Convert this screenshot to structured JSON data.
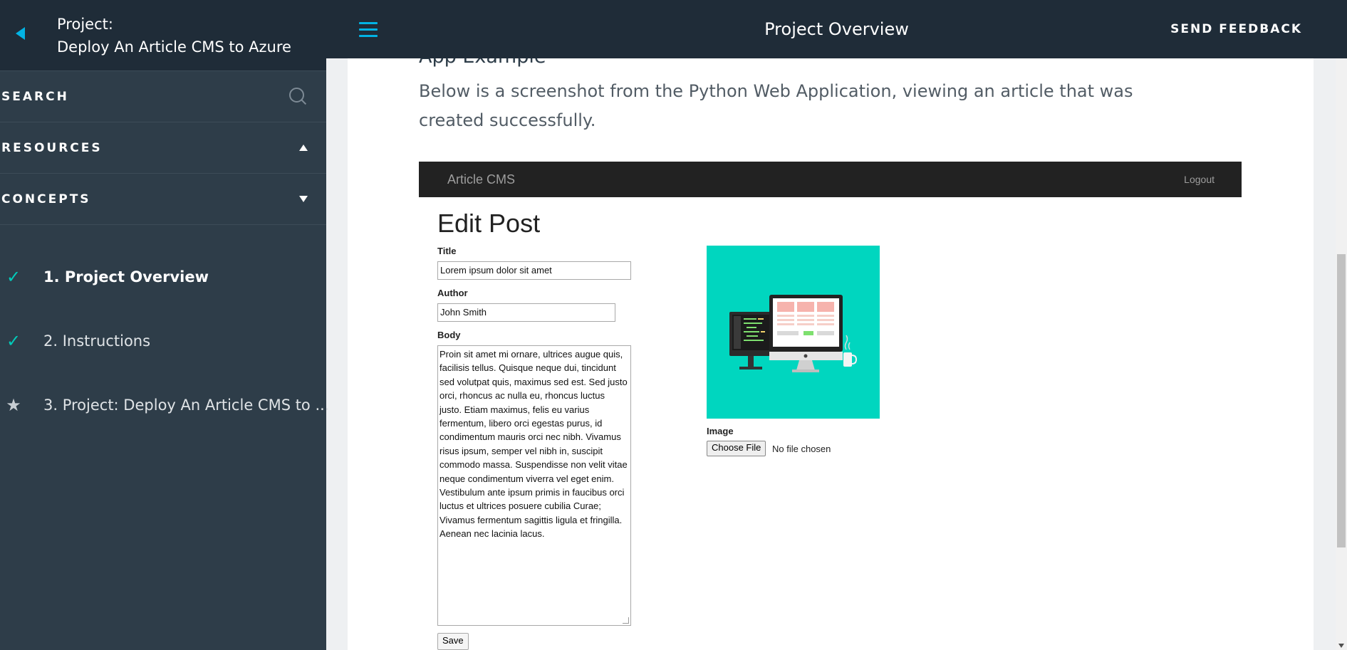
{
  "sidebar": {
    "project_label": "Project:",
    "project_name": "Deploy An Article CMS to Azure",
    "search_label": "SEARCH",
    "resources_label": "RESOURCES",
    "concepts_label": "CONCEPTS",
    "concepts": [
      {
        "label": "1. Project Overview",
        "status": "check-icon"
      },
      {
        "label": "2. Instructions",
        "status": "check-icon"
      },
      {
        "label": "3. Project: Deploy An Article CMS to ...",
        "status": "star-icon"
      }
    ]
  },
  "topbar": {
    "title": "Project Overview",
    "feedback_label": "SEND FEEDBACK"
  },
  "content": {
    "heading": "App Example",
    "paragraph": "Below is a screenshot from the Python Web Application, viewing an article that was created successfully."
  },
  "screenshot": {
    "brand": "Article CMS",
    "logout": "Logout",
    "page_title": "Edit Post",
    "title_label": "Title",
    "title_value": "Lorem ipsum dolor sit amet",
    "author_label": "Author",
    "author_value": "John Smith",
    "body_label": "Body",
    "body_value": "Proin sit amet mi ornare, ultrices augue quis, facilisis tellus. Quisque neque dui, tincidunt sed volutpat quis, maximus sed est. Sed justo orci, rhoncus ac nulla eu, rhoncus luctus justo. Etiam maximus, felis eu varius fermentum, libero orci egestas purus, id condimentum mauris orci nec nibh. Vivamus risus ipsum, semper vel nibh in, suscipit commodo massa. Suspendisse non velit vitae neque condimentum viverra vel eget enim. Vestibulum ante ipsum primis in faucibus orci luctus et ultrices posuere cubilia Curae; Vivamus fermentum sagittis ligula et fringilla. Aenean nec lacinia lacus.",
    "save_label": "Save",
    "image_label": "Image",
    "choose_file_label": "Choose File",
    "no_file_label": "No file chosen"
  },
  "colors": {
    "accent": "#02b3e4",
    "check": "#02ccba",
    "sidebar_bg": "#2e3d49",
    "header_bg": "#1f2c38",
    "image_bg": "#00d6bf"
  }
}
